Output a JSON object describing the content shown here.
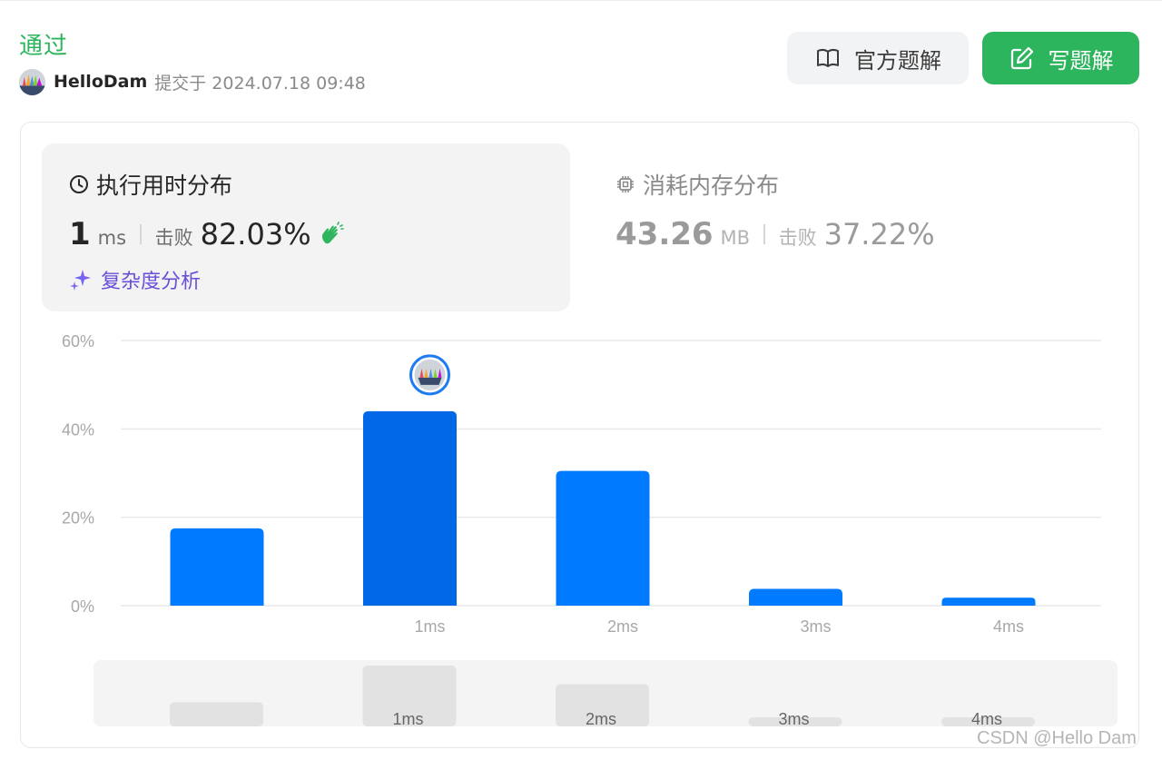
{
  "header": {
    "status": "通过",
    "user": "HelloDam",
    "submitted_at": "提交于 2024.07.18 09:48",
    "buttons": {
      "official": "官方题解",
      "write": "写题解"
    }
  },
  "runtime": {
    "title": "执行用时分布",
    "value": "1",
    "unit": "ms",
    "beat_label": "击败",
    "beat_value": "82.03%",
    "complexity_link": "复杂度分析"
  },
  "memory": {
    "title": "消耗内存分布",
    "value": "43.26",
    "unit": "MB",
    "beat_label": "击败",
    "beat_value": "37.22%"
  },
  "chart_data": {
    "type": "bar",
    "categories": [
      "",
      "1ms",
      "2ms",
      "3ms",
      "4ms"
    ],
    "values": [
      17.5,
      44,
      30.5,
      3.8,
      1.8
    ],
    "highlight_index": 1,
    "ylim": [
      0,
      60
    ],
    "y_ticks": [
      "0%",
      "20%",
      "40%",
      "60%"
    ],
    "grid": true,
    "colors": {
      "bar": "#007aff",
      "highlight": "#0068e6",
      "grid": "#e4e4e4",
      "tick": "#a8a8a8",
      "overview_bar": "#e2e2e2",
      "overview_bg": "#f4f4f4"
    },
    "overview_labels": [
      "1ms",
      "2ms",
      "3ms",
      "4ms"
    ]
  },
  "watermark": "CSDN @Hello Dam",
  "colors": {
    "accent_green": "#2db55d",
    "link_purple": "#6a4fd6"
  }
}
